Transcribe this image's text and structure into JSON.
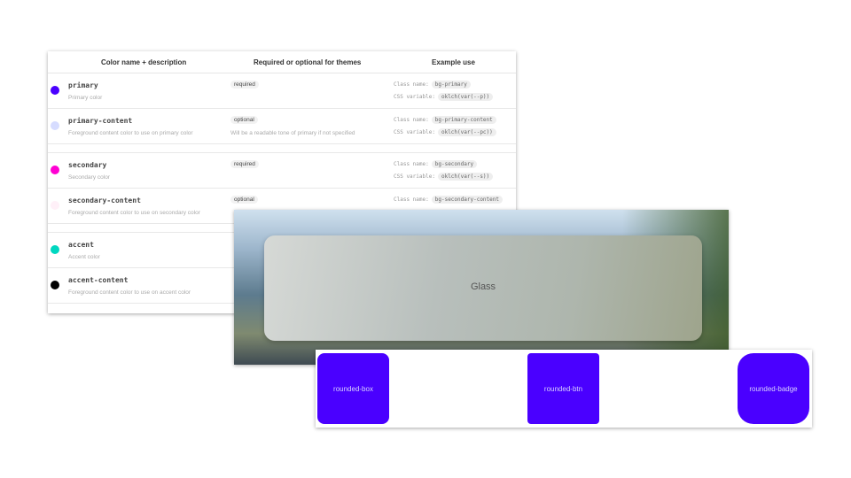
{
  "table": {
    "headers": [
      "Color name + description",
      "Required or optional for themes",
      "Example use"
    ],
    "class_label": "Class name:",
    "css_label": "CSS variable:",
    "rows": [
      {
        "name": "primary",
        "desc": "Primary color",
        "req": "required",
        "note": "",
        "class": "bg-primary",
        "css": "oklch(var(--p))",
        "color": "#4a00ff"
      },
      {
        "name": "primary-content",
        "desc": "Foreground content color to use on primary color",
        "req": "optional",
        "note": "Will be a readable tone of primary if not specified",
        "class": "bg-primary-content",
        "css": "oklch(var(--pc))",
        "color": "#d6dcff"
      },
      {
        "name": "secondary",
        "desc": "Secondary color",
        "req": "required",
        "note": "",
        "class": "bg-secondary",
        "css": "oklch(var(--s))",
        "color": "#ff00d3"
      },
      {
        "name": "secondary-content",
        "desc": "Foreground content color to use on secondary color",
        "req": "optional",
        "class": "bg-secondary-content",
        "color": "#fff0f8"
      },
      {
        "name": "accent",
        "desc": "Accent color",
        "color": "#00d7c0"
      },
      {
        "name": "accent-content",
        "desc": "Foreground content color to use on accent color",
        "color": "#000000"
      }
    ]
  },
  "glass": {
    "label": "Glass"
  },
  "buttons": [
    "rounded-box",
    "rounded-btn",
    "rounded-badge"
  ]
}
